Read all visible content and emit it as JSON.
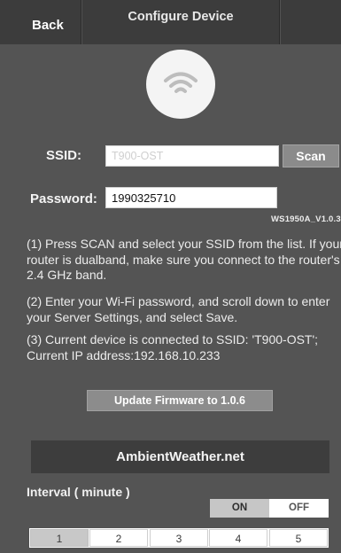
{
  "header": {
    "back_label": "Back",
    "title": "Configure Device"
  },
  "wifi_icon": "wifi-icon",
  "form": {
    "ssid_label": "SSID:",
    "ssid_placeholder": "T900-OST",
    "scan_label": "Scan",
    "password_label": "Password:",
    "password_value": "1990325710",
    "version": "WS1950A_V1.0.3"
  },
  "instructions": {
    "step1": "(1) Press SCAN and select your SSID from the list. If your router is dualband, make sure you connect to the router's 2.4 GHz band.",
    "step2": "(2) Enter your Wi-Fi password, and scroll down to enter your Server Settings, and select Save.",
    "step3": "(3) Current device is connected to SSID: 'T900-OST'; Current IP address:192.168.10.233"
  },
  "firmware_button": "Update Firmware to 1.0.6",
  "server": {
    "name": "AmbientWeather.net",
    "interval_label": "Interval ( minute )",
    "toggle_on": "ON",
    "toggle_off": "OFF",
    "toggle_selected": "ON",
    "intervals": [
      "1",
      "2",
      "3",
      "4",
      "5"
    ],
    "selected_interval": "1"
  },
  "colors": {
    "background": "#545454",
    "header": "#3c3c3c",
    "banner": "#3d3d3d",
    "button": "#8c8c8c"
  }
}
